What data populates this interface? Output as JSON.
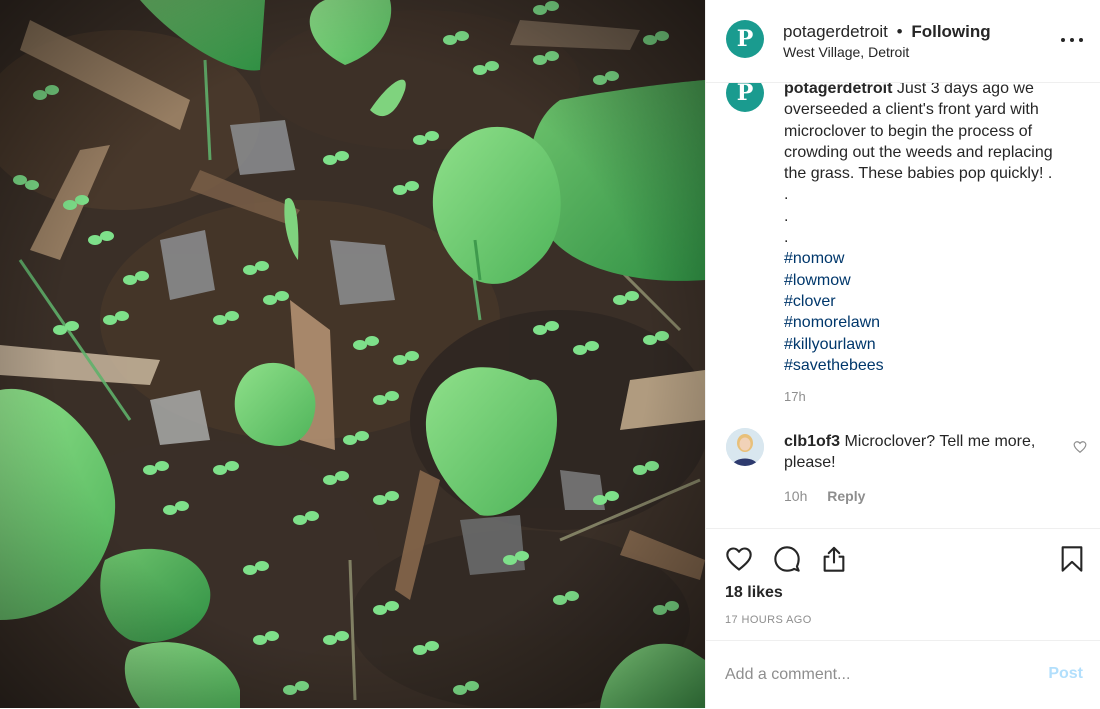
{
  "post": {
    "image_alt": "",
    "account": "potagerdetroit",
    "dot": "•",
    "follow_status": "Following",
    "location": "West Village, Detroit",
    "avatar_letter": "P",
    "caption": {
      "author": "potagerdetroit",
      "lines": [
        "Just 3 days ago we",
        "overseeded a client's front yard with",
        "microclover to begin the process of",
        "crowding out the weeds and replacing",
        "the grass. These babies pop quickly! .",
        ".",
        ".",
        "."
      ],
      "hashtags": [
        "#nomow",
        "#lowmow",
        "#clover",
        "#nomorelawn",
        "#killyourlawn",
        "#savethebees"
      ],
      "time": "17h"
    },
    "comment": {
      "author": "clb1of3",
      "text": "Microclover? Tell me more, please!",
      "time": "10h",
      "reply_label": "Reply"
    },
    "likes": "18 likes",
    "timestamp": "17 HOURS AGO",
    "add_comment_placeholder": "Add a comment...",
    "post_label": "Post"
  },
  "colors": {
    "brand_teal": "#1a9b8f",
    "hashtag": "#00376b",
    "muted": "#8e8e8e",
    "post_button_disabled": "#b2dffc"
  },
  "icons": [
    "more-icon",
    "heart-icon",
    "comment-icon",
    "share-icon",
    "bookmark-icon",
    "small-heart-icon"
  ]
}
